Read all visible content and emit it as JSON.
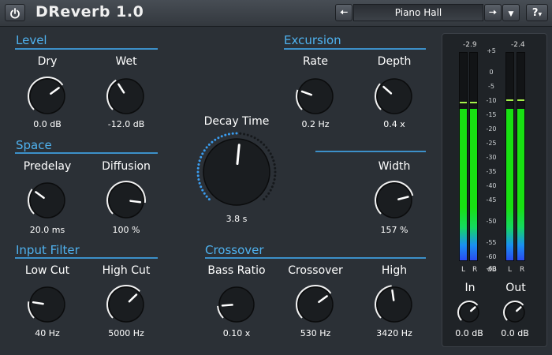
{
  "app": {
    "title": "DReverb 1.0"
  },
  "toolbar": {
    "preset": "Piano Hall",
    "help": "?"
  },
  "sections": {
    "level": "Level",
    "space": "Space",
    "input_filter": "Input Filter",
    "excursion": "Excursion",
    "crossover": "Crossover"
  },
  "knobs": {
    "dry": {
      "label": "Dry",
      "value": "0.0 dB",
      "level": 0.7
    },
    "wet": {
      "label": "Wet",
      "value": "-12.0 dB",
      "level": 0.38
    },
    "predelay": {
      "label": "Predelay",
      "value": "20.0 ms",
      "level": 0.3
    },
    "diffusion": {
      "label": "Diffusion",
      "value": "100 %",
      "level": 0.86
    },
    "low_cut": {
      "label": "Low Cut",
      "value": "40 Hz",
      "level": 0.2
    },
    "high_cut": {
      "label": "High Cut",
      "value": "5000 Hz",
      "level": 0.67
    },
    "decay_time": {
      "label": "Decay Time",
      "value": "3.8 s",
      "level": 0.52
    },
    "rate": {
      "label": "Rate",
      "value": "0.2 Hz",
      "level": 0.24
    },
    "depth": {
      "label": "Depth",
      "value": "0.4 x",
      "level": 0.32
    },
    "width": {
      "label": "Width",
      "value": "157 %",
      "level": 0.78
    },
    "bass_ratio": {
      "label": "Bass Ratio",
      "value": "0.10 x",
      "level": 0.15
    },
    "crossover_freq": {
      "label": "Crossover",
      "value": "530 Hz",
      "level": 0.7
    },
    "high": {
      "label": "High",
      "value": "3420 Hz",
      "level": 0.47
    }
  },
  "meters": {
    "in_peak_readout": "-2.9",
    "out_peak_readout": "-2.4",
    "in_label": "In",
    "out_label": "Out",
    "in_value": "0.0 dB",
    "out_value": "0.0 dB",
    "in_level": 0.73,
    "out_level": 0.73,
    "in_peak_level": 0.757,
    "out_peak_level": 0.77,
    "scale": [
      "+5",
      "0",
      "-5",
      "-10",
      "-15",
      "-20",
      "-25",
      "-30",
      "-35",
      "-40",
      "-45",
      "-50",
      "-55",
      "-60"
    ],
    "scale_unit": "dB",
    "scale_floor": "-60",
    "channels": [
      "L",
      "R"
    ],
    "in_knob_level": 0.68,
    "out_knob_level": 0.68
  },
  "colors": {
    "accent": "#4fb2f0",
    "meter_green": "#18e012",
    "meter_blue": "#2a4bf0",
    "background": "#2b3036"
  }
}
